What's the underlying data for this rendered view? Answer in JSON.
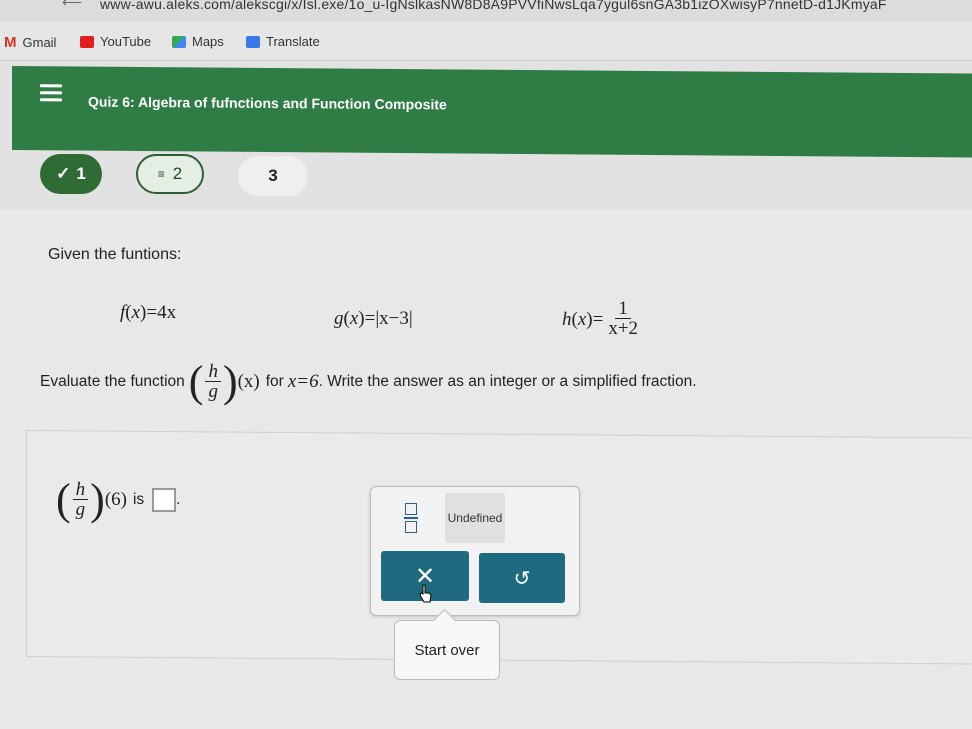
{
  "browser": {
    "url": "www-awu.aleks.com/alekscgi/x/Isl.exe/1o_u-IgNslkasNW8D8A9PVVfiNwsLqa7ygul6snGA3b1izOXwisyP7nnetD-d1JKmyaF",
    "bookmarks": [
      {
        "label": "Gmail",
        "color": "#d93025"
      },
      {
        "label": "YouTube",
        "color": "#e02020"
      },
      {
        "label": "Maps",
        "color": "#2e8b57"
      },
      {
        "label": "Translate",
        "color": "#3b78e7"
      }
    ]
  },
  "header": {
    "title": "Quiz 6: Algebra of fufnctions and Function Composite"
  },
  "questions": [
    {
      "label": "1",
      "status": "done"
    },
    {
      "label": "2",
      "status": "current"
    },
    {
      "label": "3",
      "status": "todo"
    }
  ],
  "problem": {
    "given": "Given the funtions:",
    "f": {
      "name": "f",
      "var": "x",
      "expr": "4x"
    },
    "g": {
      "name": "g",
      "var": "x",
      "expr": "|x−3|"
    },
    "h": {
      "name": "h",
      "var": "x",
      "num": "1",
      "den": "x+2"
    },
    "prompt_prefix": "Evaluate the function",
    "frac_num": "h",
    "frac_den": "g",
    "prompt_var": "(x)",
    "prompt_for": "for",
    "prompt_cond": "x=6",
    "prompt_suffix": ". Write the answer as an integer or a simplified fraction."
  },
  "answer": {
    "arg": "(6)",
    "is_label": "is",
    "period": "."
  },
  "keypad": {
    "undefined_label": "Undefined",
    "clear_symbol": "✕",
    "undo_symbol": "↺"
  },
  "tooltip": {
    "start_over": "Start over"
  }
}
